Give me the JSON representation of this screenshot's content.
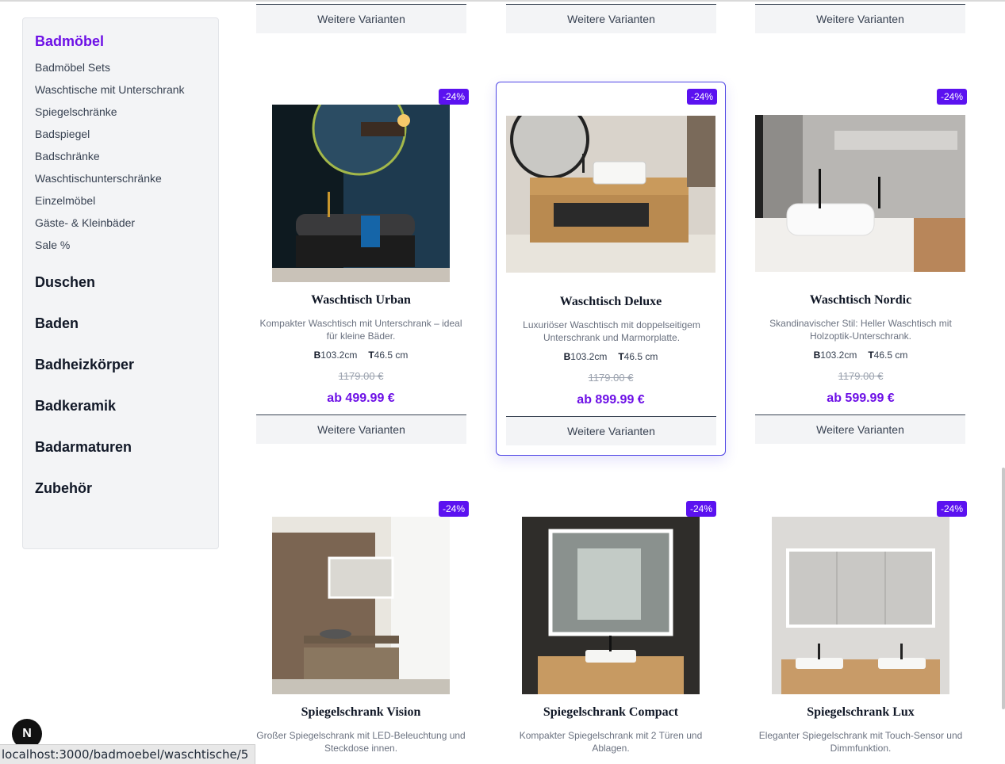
{
  "sidebar": {
    "active_category": "Badmöbel",
    "subcategories": [
      "Badmöbel Sets",
      "Waschtische mit Unterschrank",
      "Spiegelschränke",
      "Badspiegel",
      "Badschränke",
      "Waschtischunterschränke",
      "Einzelmöbel",
      "Gäste- & Kleinbäder",
      "Sale %"
    ],
    "categories": [
      "Duschen",
      "Baden",
      "Badheizkörper",
      "Badkeramik",
      "Badarmaturen",
      "Zubehör"
    ]
  },
  "top_row": {
    "button_label": "Weitere Varianten"
  },
  "products": [
    {
      "discount": "-24%",
      "title": "Waschtisch Urban",
      "description": "Kompakter Waschtisch mit Unterschrank – ideal für kleine Bäder.",
      "dim_w_label": "B",
      "dim_w": "103.2cm",
      "dim_d_label": "T",
      "dim_d": "46.5 cm",
      "old_price": "1179.00 €",
      "price": "ab 499.99 €",
      "button": "Weitere Varianten"
    },
    {
      "discount": "-24%",
      "title": "Waschtisch Deluxe",
      "description": "Luxuriöser Waschtisch mit doppelseitigem Unterschrank und Marmorplatte.",
      "dim_w_label": "B",
      "dim_w": "103.2cm",
      "dim_d_label": "T",
      "dim_d": "46.5 cm",
      "old_price": "1179.00 €",
      "price": "ab 899.99 €",
      "button": "Weitere Varianten"
    },
    {
      "discount": "-24%",
      "title": "Waschtisch Nordic",
      "description": "Skandinavischer Stil: Heller Waschtisch mit Holzoptik-Unterschrank.",
      "dim_w_label": "B",
      "dim_w": "103.2cm",
      "dim_d_label": "T",
      "dim_d": "46.5 cm",
      "old_price": "1179.00 €",
      "price": "ab 599.99 €",
      "button": "Weitere Varianten"
    },
    {
      "discount": "-24%",
      "title": "Spiegelschrank Vision",
      "description": "Großer Spiegelschrank mit LED-Beleuchtung und Steckdose innen."
    },
    {
      "discount": "-24%",
      "title": "Spiegelschrank Compact",
      "description": "Kompakter Spiegelschrank mit 2 Türen und Ablagen."
    },
    {
      "discount": "-24%",
      "title": "Spiegelschrank Lux",
      "description": "Eleganter Spiegelschrank mit Touch-Sensor und Dimmfunktion."
    }
  ],
  "status_url": "localhost:3000/badmoebel/waschtische/5",
  "dev_badge": "N",
  "colors": {
    "accent": "#6d10e6",
    "badge": "#5b12f0",
    "selected_border": "#4f46e5"
  }
}
